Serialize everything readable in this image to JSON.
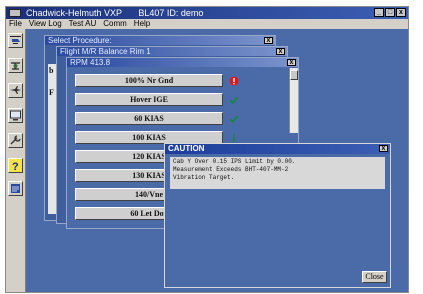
{
  "app": {
    "title": "Chadwick-Helmuth VXP",
    "title_fields": "BL407    ID: demo",
    "controls": [
      "_",
      "□",
      "x"
    ]
  },
  "menu": [
    "File",
    "View Log",
    "Test AU",
    "Comm",
    "Help"
  ],
  "toolbar": {
    "icons": [
      "helicopter-icon",
      "rotor-icon",
      "aircraft-icon",
      "monitor-icon",
      "wrench-icon",
      "help-icon",
      "log-icon"
    ],
    "bottom_icon": "pen-icon"
  },
  "select_window": {
    "title": "Select Procedure:",
    "side_letters": [
      "b",
      "F"
    ]
  },
  "balance_window": {
    "title": "Flight M/R Balance Rim 1"
  },
  "rpm_window": {
    "title": "RPM  413.8",
    "procedures": [
      {
        "label": "100% Nr Gnd",
        "status": "alert",
        "color": "#e01818"
      },
      {
        "label": "Hover IGE",
        "status": "ok",
        "color": "#0e8a3a"
      },
      {
        "label": "60 KIAS",
        "status": "ok",
        "color": "#0e8a3a"
      },
      {
        "label": "100 KIAS",
        "status": "info",
        "color": "#0e8a3a"
      },
      {
        "label": "120 KIAS",
        "status": "none"
      },
      {
        "label": "130 KIAS",
        "status": "none"
      },
      {
        "label": "140/Vne",
        "status": "none"
      },
      {
        "label": "60 Let Dov",
        "status": "none"
      }
    ]
  },
  "caution": {
    "title": "CAUTION",
    "lines": [
      "Cab Y Over 0.15 IPS Limit by 0.00.",
      "Measurement Exceeds BHT-407-MM-2",
      "Vibration Target."
    ],
    "close_label": "Close"
  }
}
